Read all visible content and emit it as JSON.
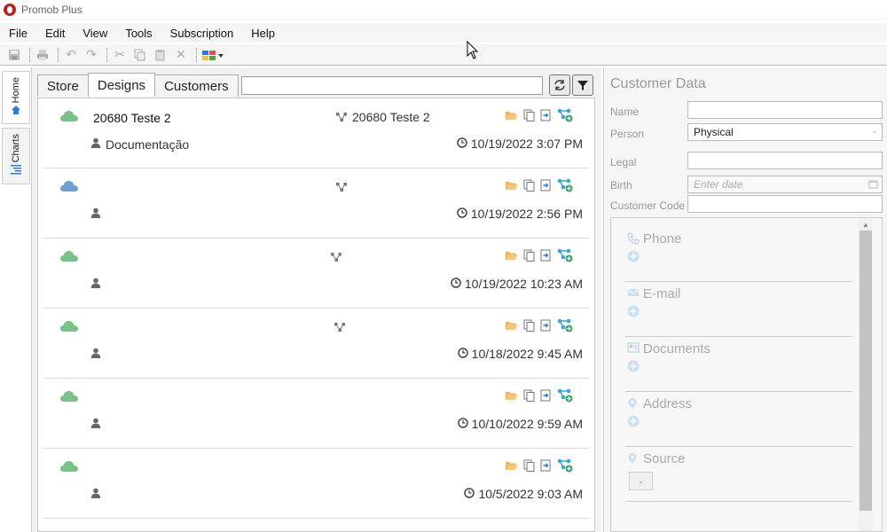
{
  "window": {
    "title": "Promob Plus"
  },
  "menu": [
    "File",
    "Edit",
    "View",
    "Tools",
    "Subscription",
    "Help"
  ],
  "sidebar": {
    "home": "Home",
    "charts": "Charts"
  },
  "tabs": [
    "Store",
    "Designs",
    "Customers"
  ],
  "search": {
    "value": ""
  },
  "designs": [
    {
      "name": "20680 Teste 2",
      "project": "20680 Teste 2",
      "customer": "Documentação",
      "date": "10/19/2022 3:07 PM",
      "cloud_color": "#7cc189"
    },
    {
      "name": "",
      "project": "",
      "customer": "",
      "date": "10/19/2022 2:56 PM",
      "cloud_color": "#6f9fcf"
    },
    {
      "name": "",
      "project": "",
      "customer": "",
      "date": "10/19/2022 10:23 AM",
      "cloud_color": "#7cc189"
    },
    {
      "name": "",
      "project": "",
      "customer": "",
      "date": "10/18/2022 9:45 AM",
      "cloud_color": "#7cc189"
    },
    {
      "name": "",
      "project": "",
      "customer": "",
      "date": "10/10/2022 9:59 AM",
      "cloud_color": "#7cc189"
    },
    {
      "name": "",
      "project": "",
      "customer": "",
      "date": "10/5/2022 9:03 AM",
      "cloud_color": "#7cc189"
    }
  ],
  "customer_data": {
    "title": "Customer Data",
    "name_label": "Name",
    "person_label": "Person",
    "person_value": "Physical",
    "legal_label": "Legal",
    "birth_label": "Birth",
    "birth_placeholder": "Enter date",
    "code_label": "Customer Code"
  },
  "contacts": {
    "phone": "Phone",
    "email": "E-mail",
    "documents": "Documents",
    "address": "Address",
    "source": "Source"
  },
  "colors": {
    "accent": "#2a7fd1",
    "cloud_green": "#7cc189",
    "cloud_blue": "#6f9fcf",
    "folder": "#f0b25a",
    "share": "#3aa6d8"
  }
}
